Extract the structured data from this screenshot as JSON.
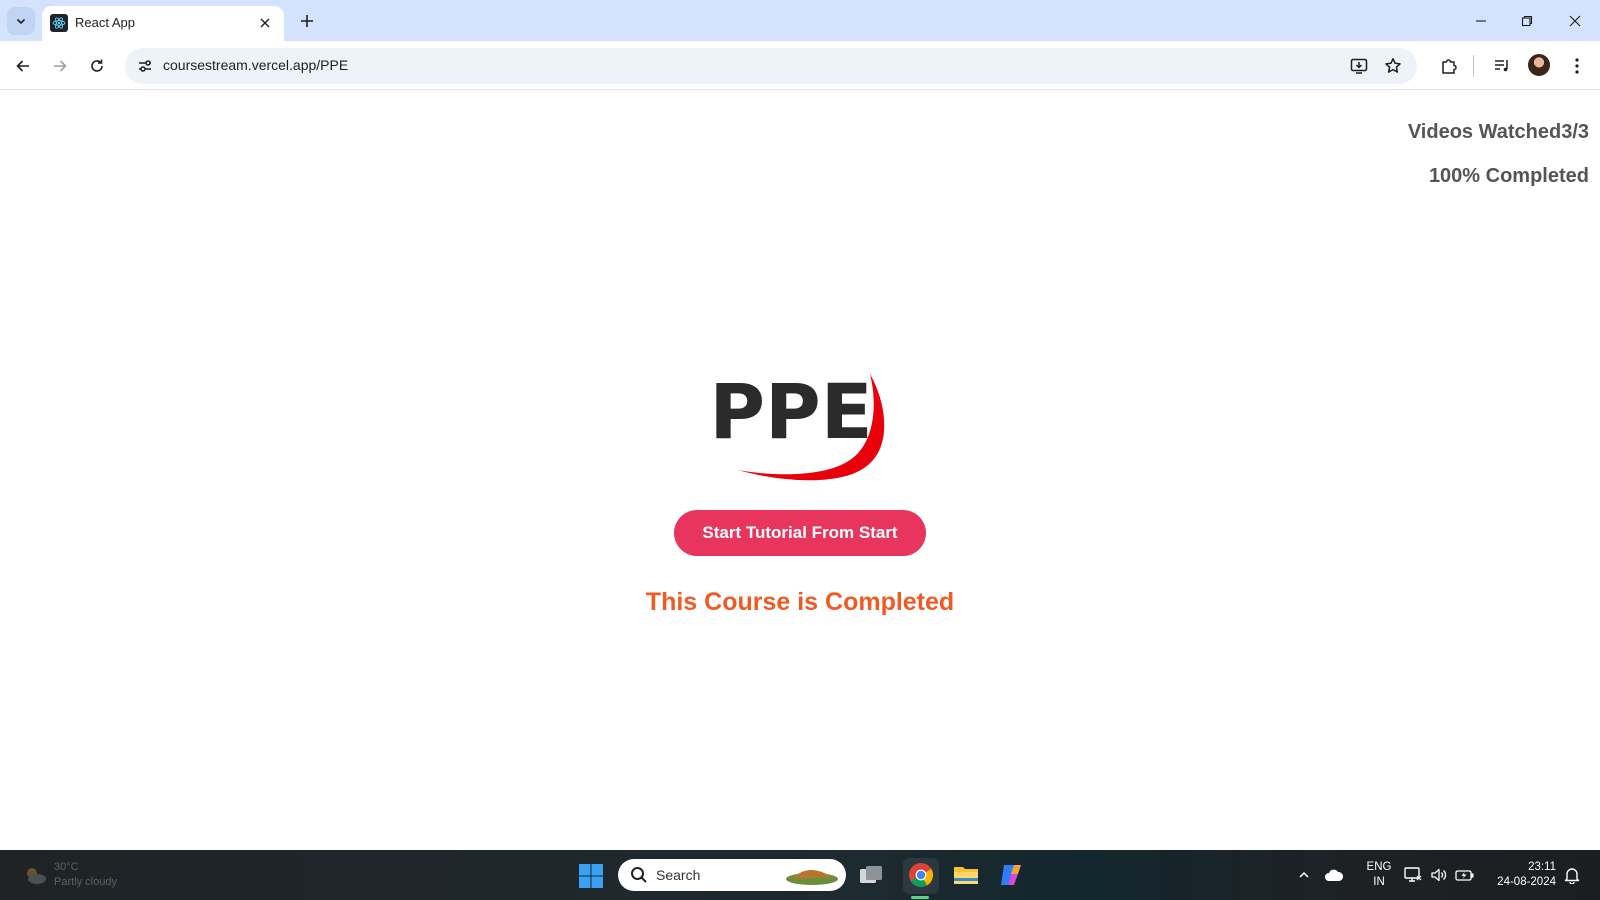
{
  "browser": {
    "tab_title": "React App",
    "url": "coursestream.vercel.app/PPE"
  },
  "page": {
    "videos_watched": "Videos Watched3/3",
    "completion": "100% Completed",
    "logo_text": "PPE",
    "start_button": "Start Tutorial From Start",
    "completed_message": "This Course is Completed"
  },
  "colors": {
    "tab_strip_bg": "#d3e3fd",
    "button_bg": "#e8355d",
    "completed_text": "#f05a24",
    "logo_swoosh": "#e8000b",
    "stat_text": "#555555"
  },
  "taskbar": {
    "weather_temp": "30°C",
    "weather_desc": "Partly cloudy",
    "search_label": "Search",
    "lang_line1": "ENG",
    "lang_line2": "IN",
    "time": "23:11",
    "date": "24-08-2024"
  }
}
